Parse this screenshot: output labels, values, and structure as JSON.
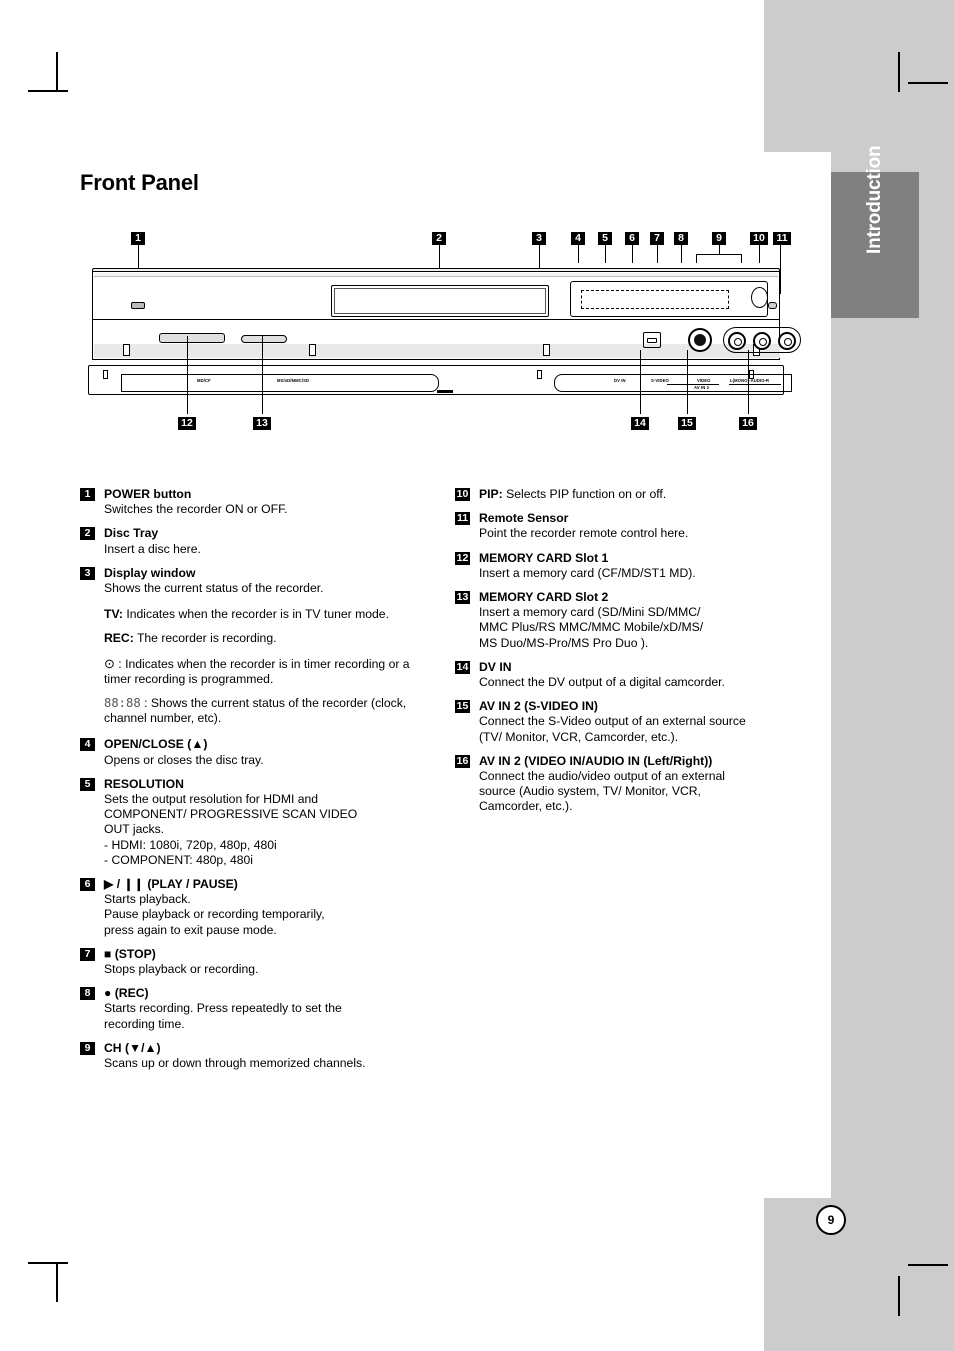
{
  "page": {
    "title": "Front Panel",
    "side_tab": "Introduction",
    "page_number": "9",
    "bg_color": "#cccccc",
    "tab_color": "#808080"
  },
  "diagram": {
    "name": "front-panel-illustration",
    "callouts": [
      "1",
      "2",
      "3",
      "4",
      "5",
      "6",
      "7",
      "8",
      "9",
      "10",
      "11",
      "12",
      "13",
      "14",
      "15",
      "16"
    ],
    "jack_labels": {
      "dv_in": "DV IN",
      "s_video": "S-VIDEO",
      "video": "VIDEO",
      "audio": "L(MONO)-AUDIO-R",
      "av_in_2": "AV IN 2",
      "slot1": "MD/CF",
      "slot2": "MS/xD/MMC/SD"
    }
  },
  "items_left": [
    {
      "num": "1",
      "title": "POWER button",
      "lines": [
        "Switches the recorder ON or OFF."
      ]
    },
    {
      "num": "2",
      "title": "Disc Tray",
      "lines": [
        "Insert a disc here."
      ]
    },
    {
      "num": "3",
      "title": "Display window",
      "lines": [
        "Shows the current status of the recorder."
      ]
    }
  ],
  "display_window_details": [
    {
      "label": "TV:",
      "text": " Indicates when the recorder is in TV tuner mode."
    },
    {
      "label": "REC:",
      "text": " The recorder is recording."
    },
    {
      "label": "clock-icon",
      "glyph": "⊙",
      "text": " : Indicates when the recorder is in timer recording or a timer recording is programmed."
    },
    {
      "label": "segment-display-icon",
      "glyph": "88:88",
      "text": " : Shows the current status of the recorder (clock, channel number, etc)."
    }
  ],
  "items_left_cont": [
    {
      "num": "4",
      "title": "OPEN/CLOSE (▲)",
      "lines": [
        "Opens or closes the disc tray."
      ]
    },
    {
      "num": "5",
      "title": "RESOLUTION",
      "lines": [
        "Sets the output resolution for HDMI and",
        "COMPONENT/ PROGRESSIVE SCAN VIDEO",
        "OUT jacks.",
        "- HDMI: 1080i, 720p, 480p, 480i",
        "- COMPONENT: 480p, 480i"
      ]
    },
    {
      "num": "6",
      "title": "▶ / ❙❙ (PLAY / PAUSE)",
      "lines": [
        "Starts playback.",
        "Pause playback or recording temporarily,",
        "press again to exit pause mode."
      ]
    },
    {
      "num": "7",
      "title": "■ (STOP)",
      "lines": [
        "Stops playback or recording."
      ]
    },
    {
      "num": "8",
      "title": "● (REC)",
      "lines": [
        "Starts recording. Press repeatedly to set the",
        "recording time."
      ]
    },
    {
      "num": "9",
      "title": "CH (▼/▲)",
      "lines": [
        "Scans up or down through memorized channels."
      ]
    }
  ],
  "items_right": [
    {
      "num": "10",
      "title": "PIP:",
      "inline": true,
      "lines": [
        " Selects PIP function on or off."
      ]
    },
    {
      "num": "11",
      "title": "Remote Sensor",
      "lines": [
        "Point the recorder remote control here."
      ]
    },
    {
      "num": "12",
      "title": "MEMORY CARD Slot 1",
      "lines": [
        "Insert a memory card (CF/MD/ST1 MD)."
      ]
    },
    {
      "num": "13",
      "title": "MEMORY CARD Slot 2",
      "lines": [
        "Insert a memory card (SD/Mini SD/MMC/",
        "MMC Plus/RS MMC/MMC Mobile/xD/MS/",
        "MS Duo/MS-Pro/MS Pro Duo )."
      ]
    },
    {
      "num": "14",
      "title": "DV IN",
      "lines": [
        "Connect the DV output of a digital camcorder."
      ]
    },
    {
      "num": "15",
      "title": "AV IN 2 (S-VIDEO IN)",
      "lines": [
        "Connect the S-Video output of an external source",
        "(TV/ Monitor, VCR, Camcorder, etc.)."
      ]
    },
    {
      "num": "16",
      "title": "AV IN 2 (VIDEO IN/AUDIO IN (Left/Right))",
      "lines": [
        "Connect the audio/video output of an external",
        "source (Audio system, TV/ Monitor, VCR,",
        "Camcorder, etc.)."
      ]
    }
  ]
}
